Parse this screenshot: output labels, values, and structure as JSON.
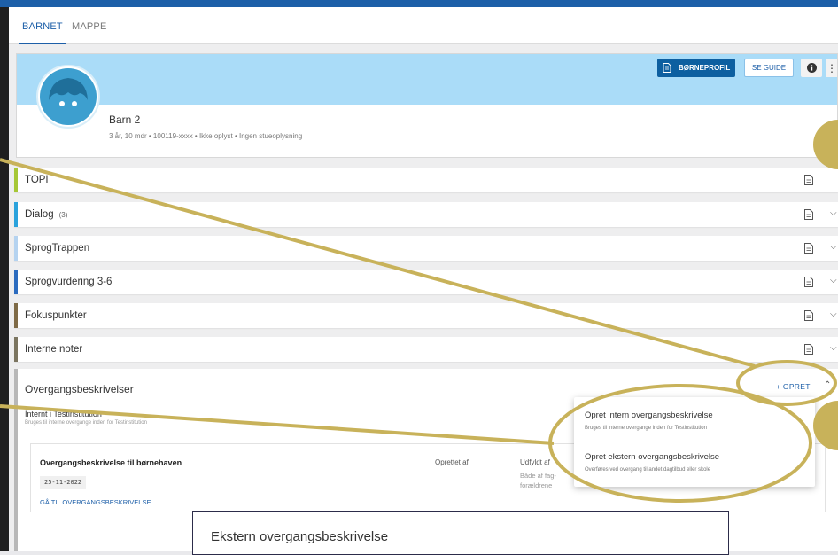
{
  "tabs": [
    {
      "label": "BARNET"
    },
    {
      "label": "MAPPE"
    }
  ],
  "profile": {
    "buttons": {
      "profile": "BØRNEPROFIL",
      "guide": "SE GUIDE",
      "more": "⋮"
    },
    "name": "Barn 2",
    "meta": "3 år, 10 mdr • 100119-xxxx • Ikke oplyst • Ingen stueoplysning"
  },
  "rows": [
    {
      "label": "TOPI",
      "count": "",
      "color": "#a6c736"
    },
    {
      "label": "Dialog",
      "count": "(3)",
      "color": "#2aa2dc"
    },
    {
      "label": "SprogTrappen",
      "count": "",
      "color": "#b5d3f0"
    },
    {
      "label": "Sprogvurdering 3-6",
      "count": "",
      "color": "#2b6bbf"
    },
    {
      "label": "Fokuspunkter",
      "count": "",
      "color": "#7e6a46"
    },
    {
      "label": "Interne noter",
      "count": "",
      "color": "#7b7560"
    }
  ],
  "section": {
    "title": "Overgangsbeskrivelser",
    "create": "+ OPRET",
    "intern_label": "Internt i Testinstitution",
    "intern_sub": "Bruges til interne overgange inden for Testinstitution",
    "card": {
      "title": "Overgangsbeskrivelse til børnehaven",
      "date": "25-11-2022",
      "link": "GÅ TIL OVERGANGSBESKRIVELSE",
      "created_by_label": "Oprettet af",
      "filled_label": "Udfyldt af",
      "filled_value": "Både af fag- forældrene"
    }
  },
  "dropdown": {
    "items": [
      {
        "title": "Opret intern overgangsbeskrivelse",
        "sub": "Bruges til interne overgange inden for Testinstitution"
      },
      {
        "title": "Opret ekstern overgangsbeskrivelse",
        "sub": "Overføres ved overgang til andet dagtilbud eller skole"
      }
    ]
  },
  "modal": {
    "title": "Ekstern overgangsbeskrivelse"
  },
  "colors": {
    "accent": "#1d5fa8",
    "banner": "#aadcf8",
    "annotation": "#c8b25a"
  }
}
